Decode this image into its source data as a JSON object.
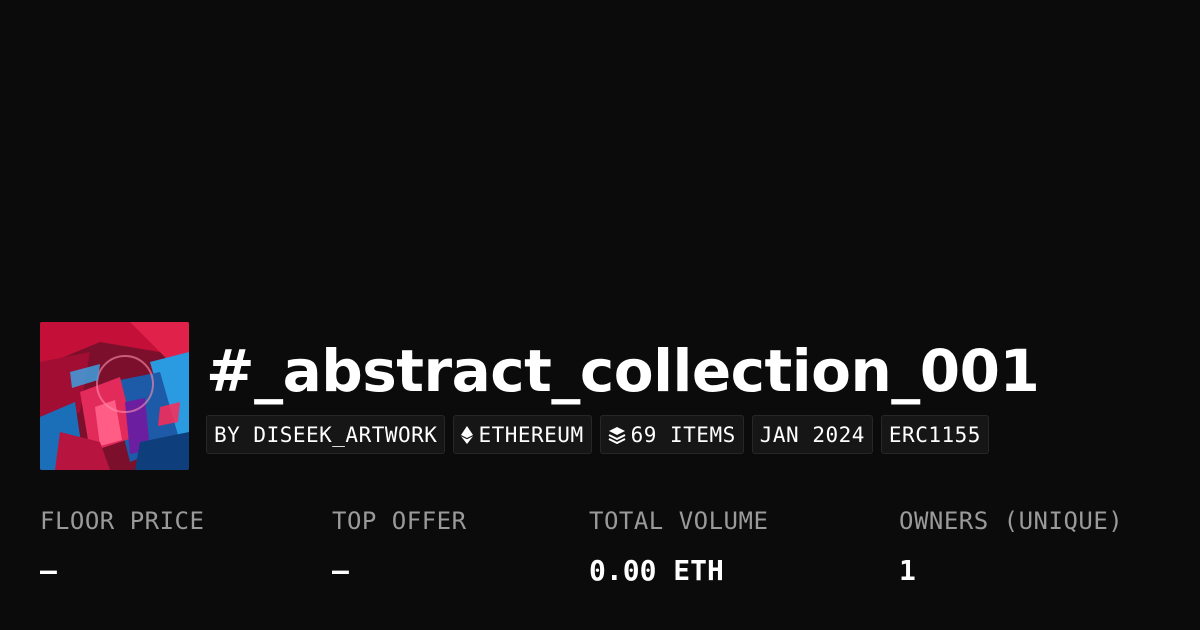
{
  "collection": {
    "title": "#_abstract_collection_001"
  },
  "tags": [
    {
      "label": "BY DISEEK_ARTWORK",
      "icon": ""
    },
    {
      "label": "ETHEREUM",
      "icon": "ethereum-icon"
    },
    {
      "label": "69 ITEMS",
      "icon": "layers-icon"
    },
    {
      "label": "JAN 2024",
      "icon": ""
    },
    {
      "label": "ERC1155",
      "icon": ""
    }
  ],
  "stats": [
    {
      "label": "FLOOR PRICE",
      "value": "–"
    },
    {
      "label": "TOP OFFER",
      "value": "–"
    },
    {
      "label": "TOTAL VOLUME",
      "value": "0.00 ETH"
    },
    {
      "label": "OWNERS (UNIQUE)",
      "value": "1"
    }
  ],
  "colors": {
    "background": "#0b0b0b",
    "tag_background": "#161616",
    "label_text": "#9a9a9a",
    "value_text": "#ffffff",
    "art_red": "#d4123f",
    "art_blue": "#1e8fd8"
  }
}
